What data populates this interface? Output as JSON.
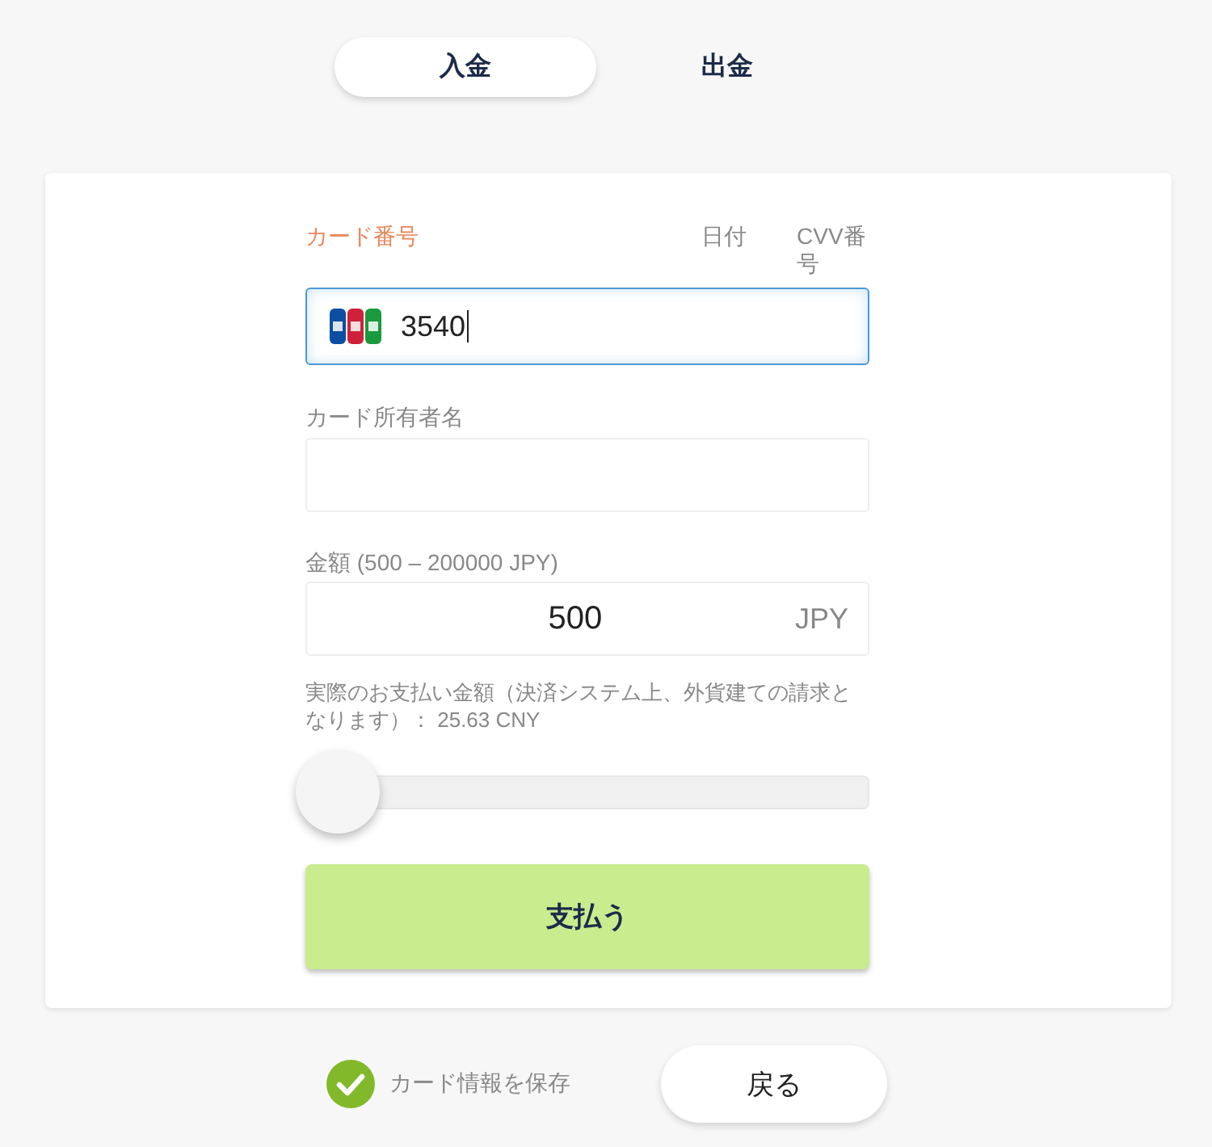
{
  "tabs": [
    {
      "label": "入金",
      "selected": true
    },
    {
      "label": "出金",
      "selected": false
    }
  ],
  "card_form": {
    "labels": [
      {
        "text": "カード番号",
        "focused": true
      },
      {
        "text": "日付",
        "focused": false
      },
      {
        "text": "CVV番号",
        "focused": false
      }
    ],
    "card_number": {
      "value": "3540",
      "focused": true
    },
    "holder": {
      "label": "カード所有者名"
    },
    "amount": {
      "label": "金額 (500 – 200000 JPY)",
      "value": "500",
      "currency": "JPY"
    },
    "note": "実際のお支払い金額（決済システム上、外貨建ての請求となります）： 25.63 CNY",
    "slider": {
      "level": 0
    },
    "pay_button": "支払う"
  },
  "save_card": {
    "label": "カード情報を保存",
    "checked": true
  },
  "back_button": "戻る"
}
